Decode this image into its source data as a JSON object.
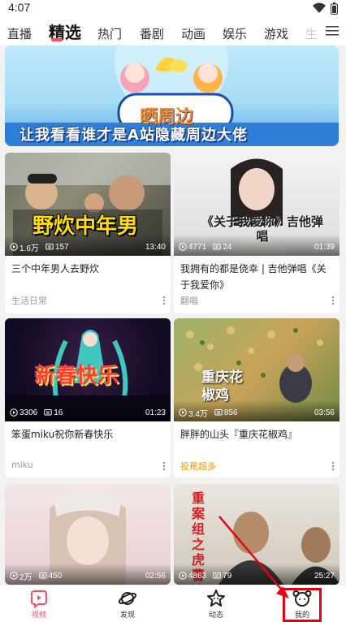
{
  "status_bar": {
    "time": "4:07"
  },
  "tabs": [
    {
      "label": "直播",
      "active": false
    },
    {
      "label": "精选",
      "active": true
    },
    {
      "label": "热门",
      "active": false
    },
    {
      "label": "番剧",
      "active": false
    },
    {
      "label": "动画",
      "active": false
    },
    {
      "label": "娱乐",
      "active": false
    },
    {
      "label": "游戏",
      "active": false
    },
    {
      "label": "生",
      "active": false
    }
  ],
  "banner": {
    "tag": "晒周边",
    "title": "让我看看谁才是A站隐藏周边大佬"
  },
  "cards": [
    {
      "overlay": "野炊中年男",
      "plays": "1.6万",
      "comments": "157",
      "duration": "13:40",
      "title": "三个中年男人去野炊",
      "sub": "生活日常",
      "sub_style": "normal"
    },
    {
      "overlay": "《关于我爱你》吉他弹唱",
      "plays": "4771",
      "comments": "24",
      "duration": "01:39",
      "title": "我拥有的都是侥幸 | 吉他弹唱《关于我爱你》",
      "sub": "翻唱",
      "sub_style": "normal"
    },
    {
      "overlay": "新春快乐",
      "plays": "3306",
      "comments": "16",
      "duration": "01:23",
      "title": "笨蛋miku祝你新春快乐",
      "sub": "miku",
      "sub_style": "normal"
    },
    {
      "overlay": "重庆花椒鸡",
      "plays": "3.4万",
      "comments": "856",
      "duration": "03:56",
      "title": "胖胖的山头『重庆花椒鸡』",
      "sub": "投蕉超多",
      "sub_style": "promo"
    },
    {
      "overlay": "",
      "plays": "2万",
      "comments": "450",
      "duration": "02:56"
    },
    {
      "overlay": "重案组之虎 曹达华",
      "plays": "4863",
      "comments": "79",
      "duration": "25:27"
    }
  ],
  "bottom_nav": [
    {
      "label": "视频",
      "icon": "video-icon",
      "active": true
    },
    {
      "label": "发现",
      "icon": "planet-icon",
      "active": false
    },
    {
      "label": "动态",
      "icon": "star-icon",
      "active": false
    },
    {
      "label": "我的",
      "icon": "profile-icon",
      "active": false
    }
  ],
  "colors": {
    "accent": "#fd4c5d",
    "highlight": "#e60012",
    "promo": "#f39c12"
  }
}
